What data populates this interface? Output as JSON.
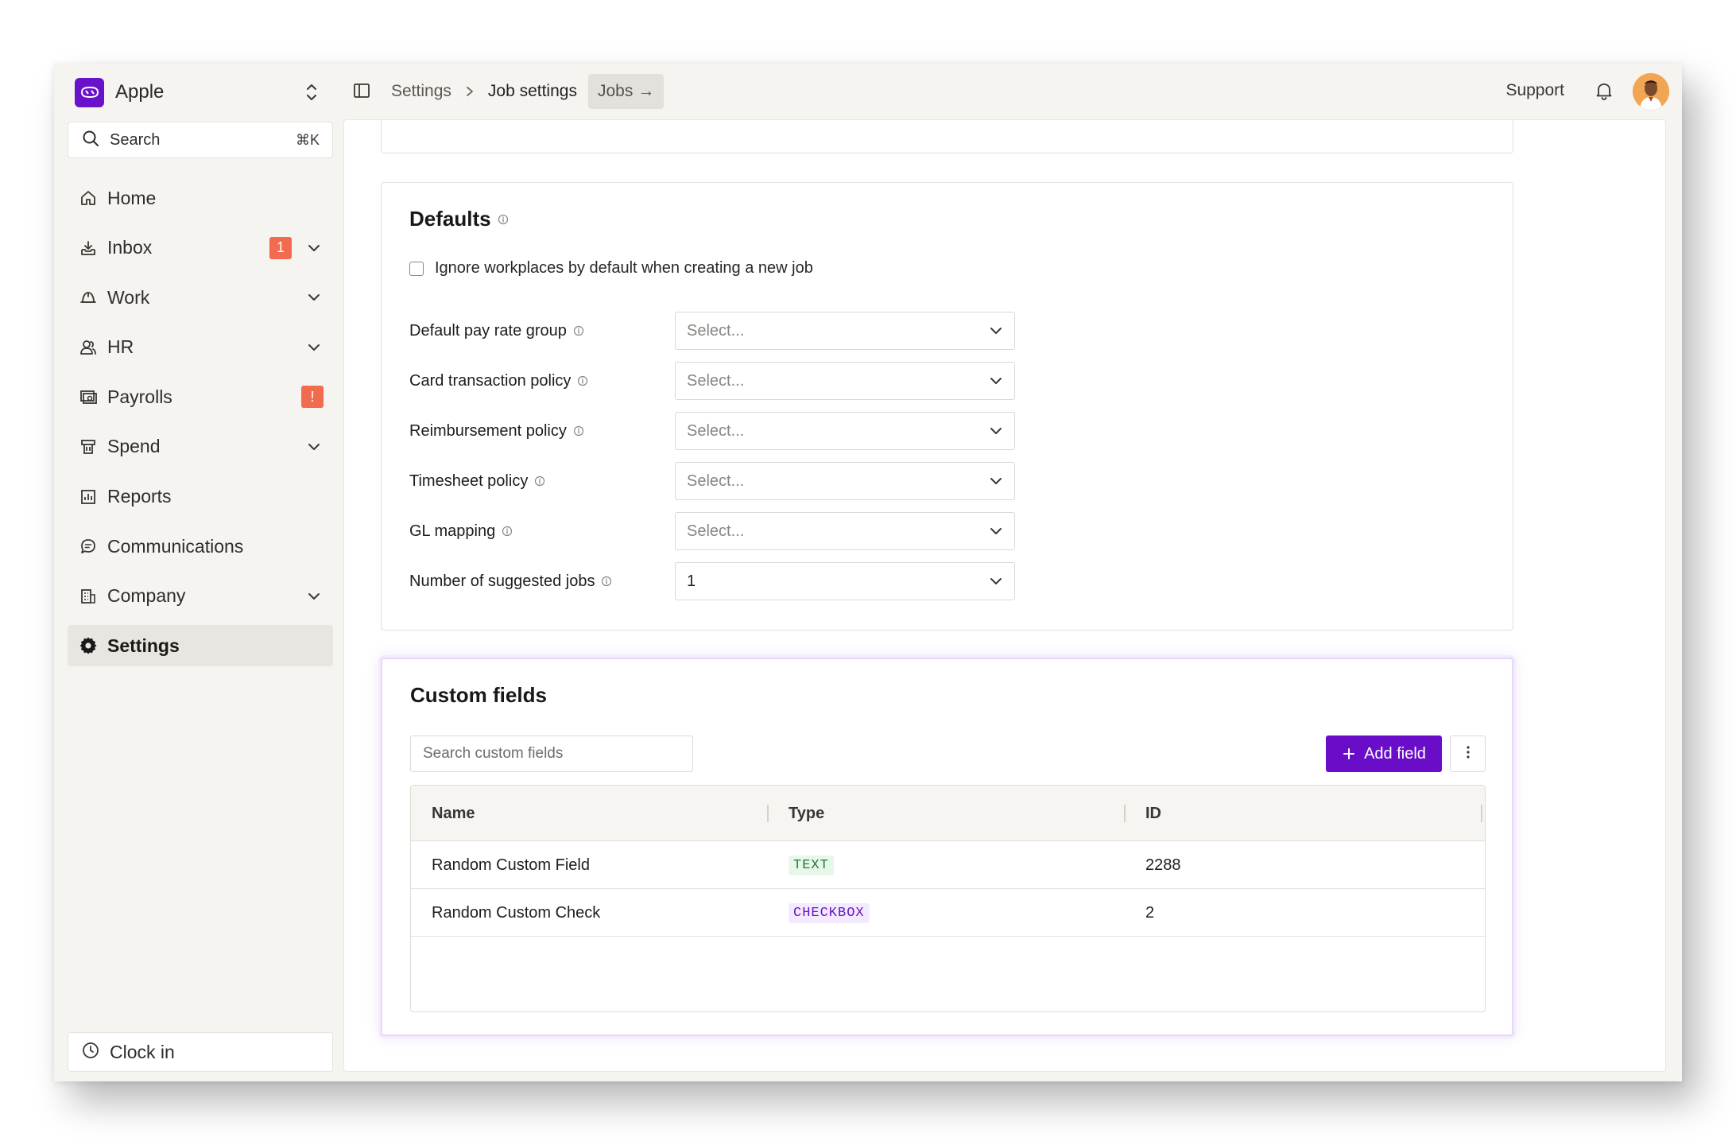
{
  "org": {
    "name": "Apple"
  },
  "search": {
    "label": "Search",
    "shortcut": "⌘K"
  },
  "nav": [
    {
      "label": "Home",
      "icon": "home-icon"
    },
    {
      "label": "Inbox",
      "icon": "inbox-icon",
      "badge": "1",
      "expandable": true
    },
    {
      "label": "Work",
      "icon": "work-icon",
      "expandable": true
    },
    {
      "label": "HR",
      "icon": "people-icon",
      "expandable": true
    },
    {
      "label": "Payrolls",
      "icon": "payroll-icon",
      "badge": "!"
    },
    {
      "label": "Spend",
      "icon": "spend-icon",
      "expandable": true
    },
    {
      "label": "Reports",
      "icon": "reports-icon"
    },
    {
      "label": "Communications",
      "icon": "chat-icon"
    },
    {
      "label": "Company",
      "icon": "building-icon",
      "expandable": true
    },
    {
      "label": "Settings",
      "icon": "gear-icon",
      "active": true
    }
  ],
  "clock_in": {
    "label": "Clock in"
  },
  "breadcrumb": {
    "root": "Settings",
    "current": "Job settings",
    "link": "Jobs",
    "link_arrow": "→"
  },
  "topbar": {
    "support": "Support"
  },
  "defaults": {
    "title": "Defaults",
    "checkbox_label": "Ignore workplaces by default when creating a new job",
    "fields": [
      {
        "label": "Default pay rate group",
        "value": "Select..."
      },
      {
        "label": "Card transaction policy",
        "value": "Select..."
      },
      {
        "label": "Reimbursement policy",
        "value": "Select..."
      },
      {
        "label": "Timesheet policy",
        "value": "Select..."
      },
      {
        "label": "GL mapping",
        "value": "Select..."
      },
      {
        "label": "Number of suggested jobs",
        "value": "1"
      }
    ]
  },
  "custom_fields": {
    "title": "Custom fields",
    "search_placeholder": "Search custom fields",
    "add_label": "Add field",
    "columns": [
      "Name",
      "Type",
      "ID"
    ],
    "rows": [
      {
        "name": "Random Custom Field",
        "type": "TEXT",
        "id": "2288"
      },
      {
        "name": "Random Custom Check",
        "type": "CHECKBOX",
        "id": "2"
      }
    ]
  },
  "colors": {
    "brand": "#6a0dc9",
    "badge": "#f26b4f",
    "text_tag": "#1f7a35",
    "checkbox_tag": "#6a11cb"
  }
}
